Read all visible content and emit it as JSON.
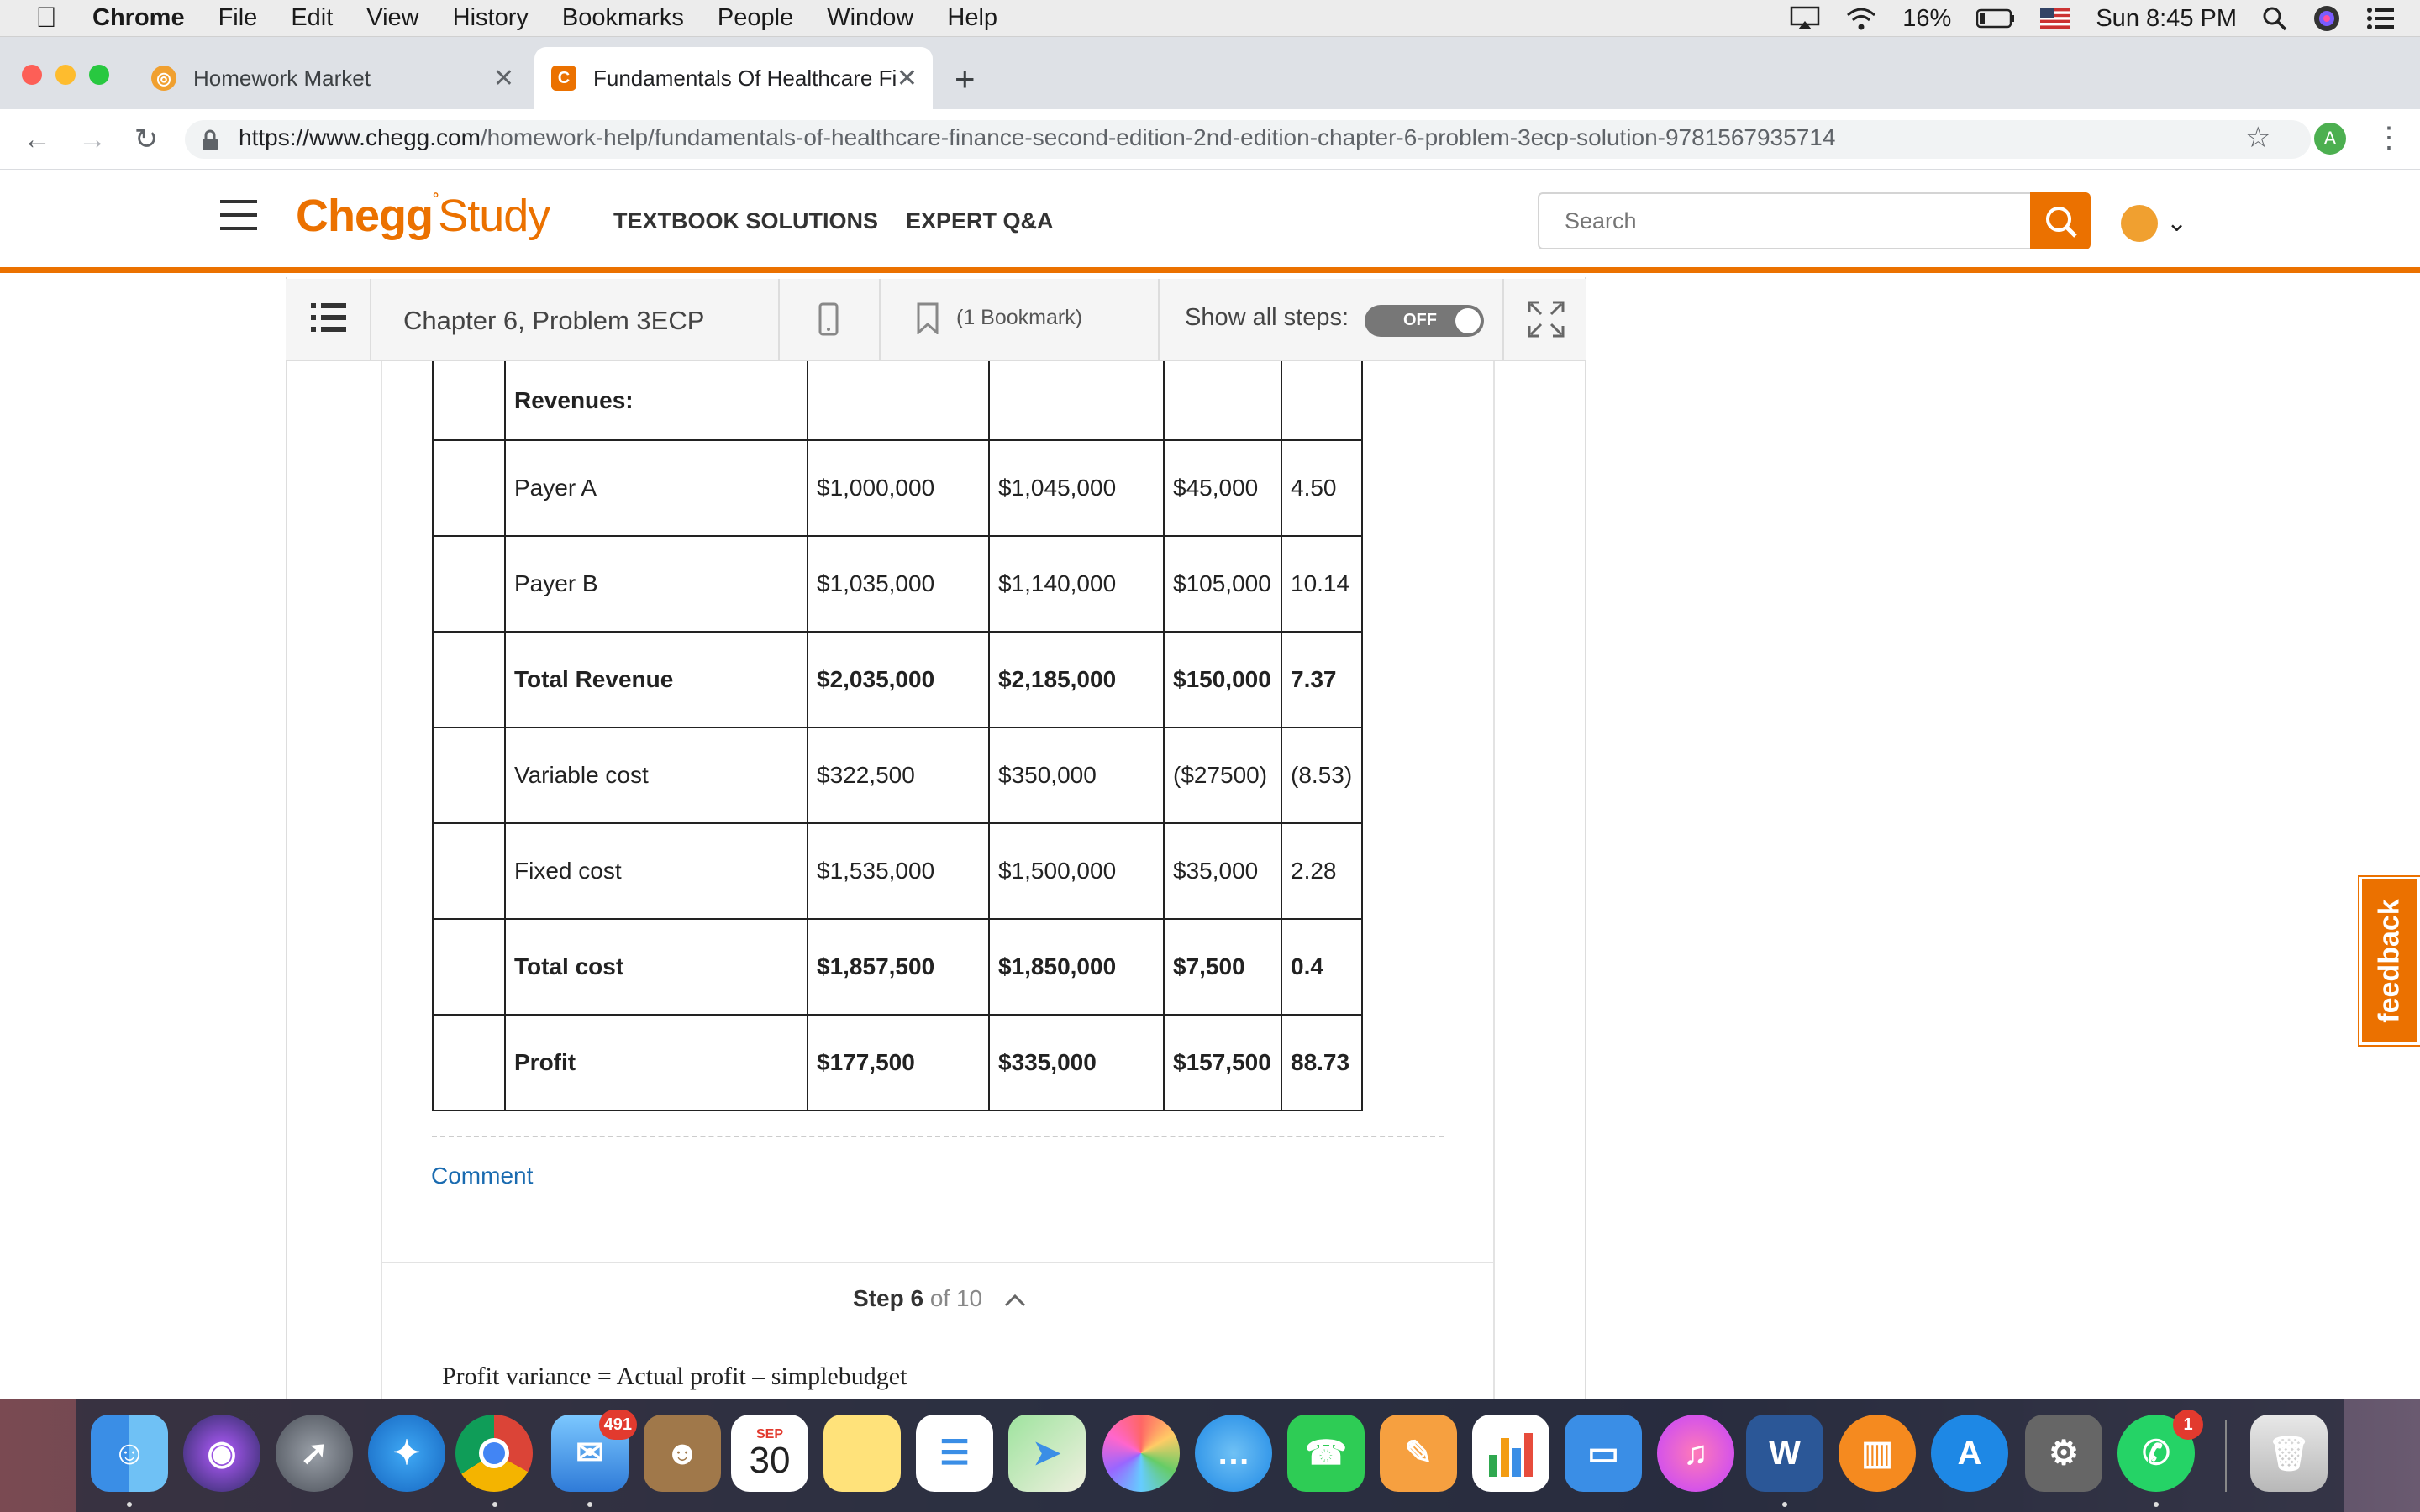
{
  "menubar": {
    "app": "Chrome",
    "items": [
      "File",
      "Edit",
      "View",
      "History",
      "Bookmarks",
      "People",
      "Window",
      "Help"
    ],
    "battery": "16%",
    "clock": "Sun 8:45 PM"
  },
  "tabs": [
    {
      "title": "Homework Market"
    },
    {
      "title": "Fundamentals Of Healthcare Fi"
    }
  ],
  "address": {
    "host": "https://www.chegg.com",
    "path": "/homework-help/fundamentals-of-healthcare-finance-second-edition-2nd-edition-chapter-6-problem-3ecp-solution-9781567935714",
    "profile_initial": "A"
  },
  "header": {
    "logo_main": "Chegg",
    "logo_sub": "Study",
    "nav": [
      "TEXTBOOK SOLUTIONS",
      "EXPERT Q&A"
    ],
    "search_placeholder": "Search"
  },
  "solution_bar": {
    "title": "Chapter 6, Problem 3ECP",
    "bookmark": "(1 Bookmark)",
    "show_steps_label": "Show all steps:",
    "toggle": "OFF"
  },
  "table": {
    "rows": [
      {
        "label": "Revenues:",
        "c1": "",
        "c2": "",
        "c3": "",
        "c4": "",
        "bold": true
      },
      {
        "label": "Payer A",
        "c1": "$1,000,000",
        "c2": "$1,045,000",
        "c3": "$45,000",
        "c4": "4.50",
        "bold": false
      },
      {
        "label": "Payer B",
        "c1": "$1,035,000",
        "c2": "$1,140,000",
        "c3": "$105,000",
        "c4": "10.14",
        "bold": false
      },
      {
        "label": "Total Revenue",
        "c1": "$2,035,000",
        "c2": "$2,185,000",
        "c3": "$150,000",
        "c4": "7.37",
        "bold": true
      },
      {
        "label": "Variable cost",
        "c1": "$322,500",
        "c2": "$350,000",
        "c3": "($27500)",
        "c4": "(8.53)",
        "bold": false
      },
      {
        "label": "Fixed cost",
        "c1": "$1,535,000",
        "c2": "$1,500,000",
        "c3": "$35,000",
        "c4": "2.28",
        "bold": false
      },
      {
        "label": "Total cost",
        "c1": "$1,857,500",
        "c2": "$1,850,000",
        "c3": "$7,500",
        "c4": "0.4",
        "bold": true
      },
      {
        "label": "Profit",
        "c1": "$177,500",
        "c2": "$335,000",
        "c3": "$157,500",
        "c4": "88.73",
        "bold": true
      }
    ]
  },
  "comment": "Comment",
  "step": {
    "current": "Step 6",
    "of": "of 10"
  },
  "formula": "Profit variance = Actual profit – simplebudget",
  "feedback": "feedback",
  "dock": {
    "mail_badge": "491",
    "calendar_month": "SEP",
    "calendar_day": "30",
    "whatsapp_badge": "1"
  }
}
